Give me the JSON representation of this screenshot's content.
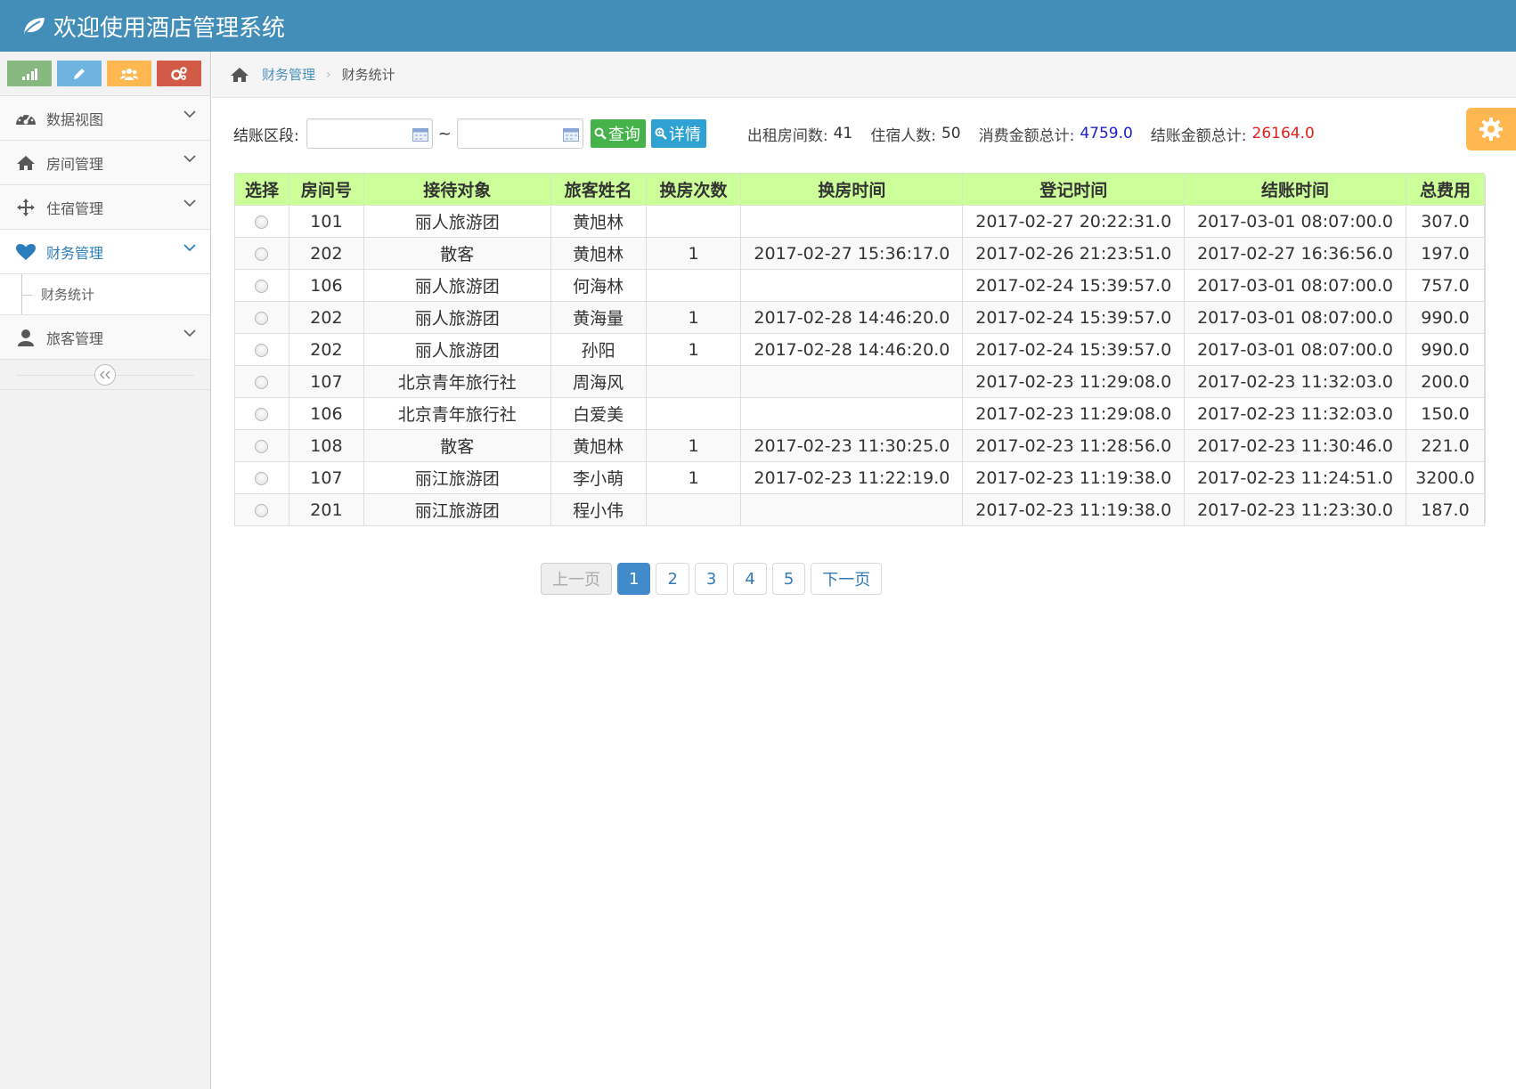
{
  "header": {
    "title": "欢迎使用酒店管理系统"
  },
  "shortcuts": [
    {
      "icon": "signal-icon",
      "color": "#87b87f"
    },
    {
      "icon": "pencil-icon",
      "color": "#6fb3e0"
    },
    {
      "icon": "group-icon",
      "color": "#ffb752"
    },
    {
      "icon": "cogs-icon",
      "color": "#d15b47"
    }
  ],
  "sidebar": {
    "items": [
      {
        "label": "数据视图",
        "icon": "dashboard-icon"
      },
      {
        "label": "房间管理",
        "icon": "home-icon"
      },
      {
        "label": "住宿管理",
        "icon": "move-icon"
      },
      {
        "label": "财务管理",
        "icon": "heart-icon",
        "active": true
      },
      {
        "label": "旅客管理",
        "icon": "user-icon"
      }
    ],
    "sub_items": [
      {
        "label": "财务统计"
      }
    ]
  },
  "breadcrumb": {
    "parent": "财务管理",
    "current": "财务统计"
  },
  "filter": {
    "label": "结账区段:",
    "start_value": "",
    "end_value": "",
    "separator": "~",
    "query_label": "查询",
    "detail_label": "详情"
  },
  "stats": {
    "rooms_label": "出租房间数:",
    "rooms_value": "41",
    "guests_label": "住宿人数:",
    "guests_value": "50",
    "consume_label": "消费金额总计:",
    "consume_value": "4759.0",
    "consume_color": "#1e1ec8",
    "checkout_label": "结账金额总计:",
    "checkout_value": "26164.0",
    "checkout_color": "#e0201e"
  },
  "table": {
    "headers": [
      "选择",
      "房间号",
      "接待对象",
      "旅客姓名",
      "换房次数",
      "换房时间",
      "登记时间",
      "结账时间",
      "总费用"
    ],
    "rows": [
      [
        "101",
        "丽人旅游团",
        "黄旭林",
        "",
        "",
        "2017-02-27 20:22:31.0",
        "2017-03-01 08:07:00.0",
        "307.0"
      ],
      [
        "202",
        "散客",
        "黄旭林",
        "1",
        "2017-02-27 15:36:17.0",
        "2017-02-26 21:23:51.0",
        "2017-02-27 16:36:56.0",
        "197.0"
      ],
      [
        "106",
        "丽人旅游团",
        "何海林",
        "",
        "",
        "2017-02-24 15:39:57.0",
        "2017-03-01 08:07:00.0",
        "757.0"
      ],
      [
        "202",
        "丽人旅游团",
        "黄海量",
        "1",
        "2017-02-28 14:46:20.0",
        "2017-02-24 15:39:57.0",
        "2017-03-01 08:07:00.0",
        "990.0"
      ],
      [
        "202",
        "丽人旅游团",
        "孙阳",
        "1",
        "2017-02-28 14:46:20.0",
        "2017-02-24 15:39:57.0",
        "2017-03-01 08:07:00.0",
        "990.0"
      ],
      [
        "107",
        "北京青年旅行社",
        "周海风",
        "",
        "",
        "2017-02-23 11:29:08.0",
        "2017-02-23 11:32:03.0",
        "200.0"
      ],
      [
        "106",
        "北京青年旅行社",
        "白爱美",
        "",
        "",
        "2017-02-23 11:29:08.0",
        "2017-02-23 11:32:03.0",
        "150.0"
      ],
      [
        "108",
        "散客",
        "黄旭林",
        "1",
        "2017-02-23 11:30:25.0",
        "2017-02-23 11:28:56.0",
        "2017-02-23 11:30:46.0",
        "221.0"
      ],
      [
        "107",
        "丽江旅游团",
        "李小萌",
        "1",
        "2017-02-23 11:22:19.0",
        "2017-02-23 11:19:38.0",
        "2017-02-23 11:24:51.0",
        "3200.0"
      ],
      [
        "201",
        "丽江旅游团",
        "程小伟",
        "",
        "",
        "2017-02-23 11:19:38.0",
        "2017-02-23 11:23:30.0",
        "187.0"
      ]
    ]
  },
  "pagination": {
    "prev": "上一页",
    "pages": [
      "1",
      "2",
      "3",
      "4",
      "5"
    ],
    "current": "1",
    "next": "下一页"
  },
  "colors": {
    "header_bg": "#438eb9",
    "table_header_bg": "#ccff99",
    "query_btn": "#45b349",
    "detail_btn": "#2fa1d3",
    "settings_btn": "#ffb752"
  }
}
